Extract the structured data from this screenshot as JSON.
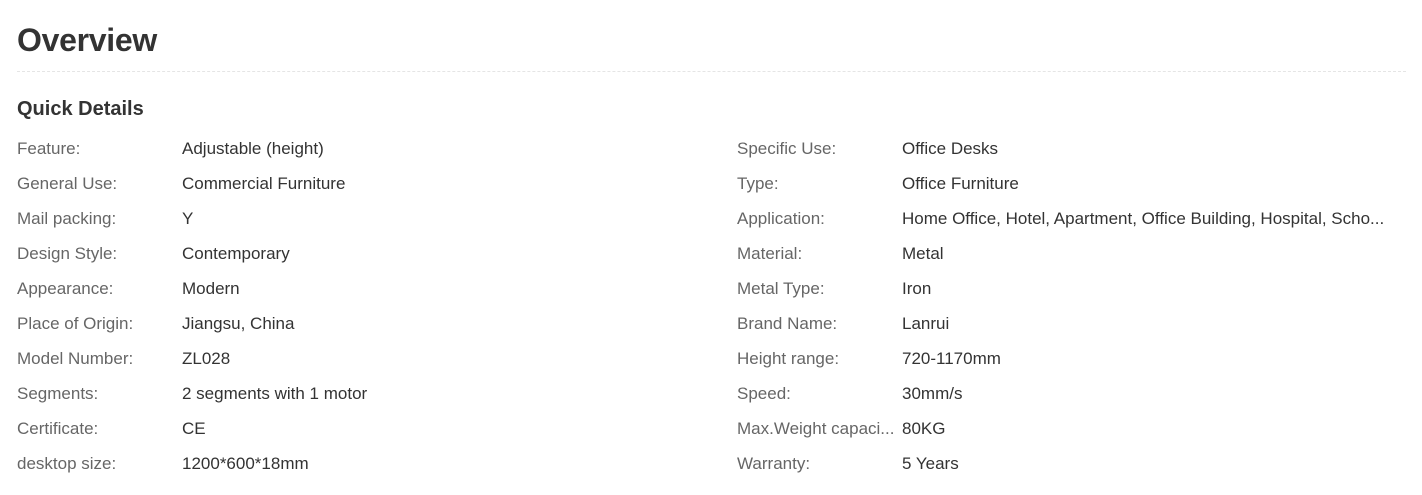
{
  "page": {
    "title": "Overview",
    "section_title": "Quick Details"
  },
  "left_details": [
    {
      "label": "Feature:",
      "value": "Adjustable (height)"
    },
    {
      "label": "General Use:",
      "value": "Commercial Furniture"
    },
    {
      "label": "Mail packing:",
      "value": "Y"
    },
    {
      "label": "Design Style:",
      "value": "Contemporary"
    },
    {
      "label": "Appearance:",
      "value": "Modern"
    },
    {
      "label": "Place of Origin:",
      "value": "Jiangsu, China"
    },
    {
      "label": "Model Number:",
      "value": "ZL028"
    },
    {
      "label": "Segments:",
      "value": "2 segments with 1 motor"
    },
    {
      "label": "Certificate:",
      "value": "CE"
    },
    {
      "label": "desktop size:",
      "value": "1200*600*18mm"
    }
  ],
  "right_details": [
    {
      "label": "Specific Use:",
      "value": "Office Desks"
    },
    {
      "label": "Type:",
      "value": "Office Furniture"
    },
    {
      "label": "Application:",
      "value": "Home Office, Hotel, Apartment, Office Building, Hospital, Scho..."
    },
    {
      "label": "Material:",
      "value": "Metal"
    },
    {
      "label": "Metal Type:",
      "value": "Iron"
    },
    {
      "label": "Brand Name:",
      "value": "Lanrui"
    },
    {
      "label": "Height range:",
      "value": "720-1170mm"
    },
    {
      "label": "Speed:",
      "value": "30mm/s"
    },
    {
      "label": "Max.Weight capaci...",
      "value": "80KG"
    },
    {
      "label": "Warranty:",
      "value": "5 Years"
    }
  ]
}
